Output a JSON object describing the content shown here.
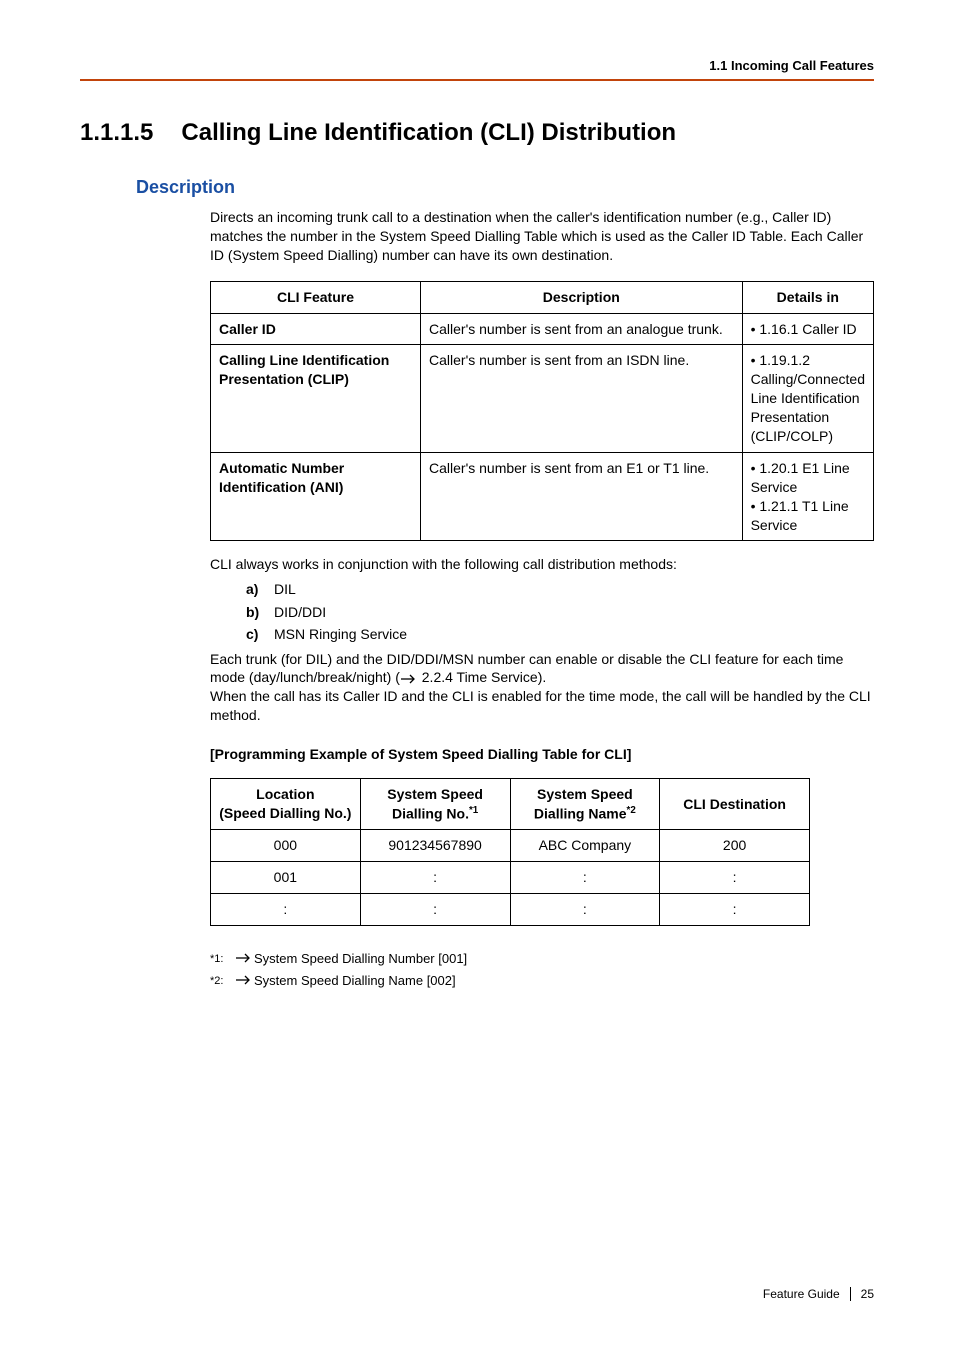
{
  "header": {
    "breadcrumb": "1.1 Incoming Call Features"
  },
  "section": {
    "number": "1.1.1.5",
    "title": "Calling Line Identification (CLI) Distribution"
  },
  "description": {
    "heading": "Description",
    "intro": "Directs an incoming trunk call to a destination when the caller's identification number (e.g., Caller ID) matches the number in the System Speed Dialling Table which is used as the Caller ID Table. Each Caller ID (System Speed Dialling) number can have its own destination."
  },
  "cli_table": {
    "headers": [
      "CLI Feature",
      "Description",
      "Details in"
    ],
    "rows": [
      {
        "feature": "Caller ID",
        "desc": "Caller's number is sent from an analogue trunk.",
        "details": "• 1.16.1 Caller ID"
      },
      {
        "feature": "Calling Line Identification Presentation (CLIP)",
        "desc": "Caller's number is sent from an ISDN line.",
        "details": "• 1.19.1.2 Calling/Connected Line Identification Presentation (CLIP/COLP)"
      },
      {
        "feature": "Automatic Number Identification (ANI)",
        "desc": "Caller's number is sent from an E1 or T1 line.",
        "details": "• 1.20.1 E1 Line Service\n• 1.21.1 T1 Line Service"
      }
    ]
  },
  "after_table": {
    "lead": "CLI always works in conjunction with the following call distribution methods:",
    "items": [
      {
        "letter": "a)",
        "text": "DIL"
      },
      {
        "letter": "b)",
        "text": "DID/DDI"
      },
      {
        "letter": "c)",
        "text": "MSN Ringing Service"
      }
    ],
    "para1a": "Each trunk (for DIL) and the DID/DDI/MSN number can enable or disable the CLI feature for each time mode (day/lunch/break/night) (",
    "para1b": " 2.2.4 Time Service).",
    "para2": "When the call has its Caller ID and the CLI is enabled for the time mode, the call will be handled by the CLI method."
  },
  "prog_heading": "[Programming Example of System Speed Dialling Table for CLI]",
  "speed_table": {
    "headers": [
      {
        "line1": "Location",
        "line2": "(Speed Dialling No.)",
        "sup": ""
      },
      {
        "line1": "System Speed",
        "line2": "Dialling No.",
        "sup": "*1"
      },
      {
        "line1": "System Speed",
        "line2": "Dialling Name",
        "sup": "*2"
      },
      {
        "line1": "CLI Destination",
        "line2": "",
        "sup": ""
      }
    ],
    "rows": [
      [
        "000",
        "901234567890",
        "ABC Company",
        "200"
      ],
      [
        "001",
        ":",
        ":",
        ":"
      ],
      [
        ":",
        ":",
        ":",
        ":"
      ]
    ]
  },
  "footnotes": [
    {
      "mark": "*1:",
      "text": "System Speed Dialling Number [001]"
    },
    {
      "mark": "*2:",
      "text": "System Speed Dialling Name [002]"
    }
  ],
  "footer": {
    "label": "Feature Guide",
    "page": "25"
  }
}
